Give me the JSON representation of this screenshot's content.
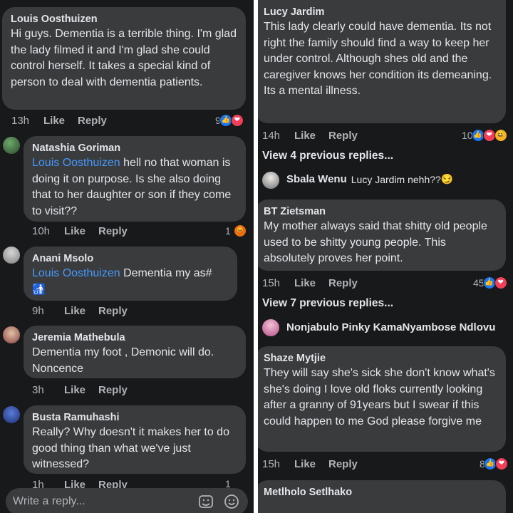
{
  "left": {
    "comments": [
      {
        "name": "Louis Oosthuizen",
        "text": "Hi guys. Dementia is a terrible thing. I'm glad the lady filmed it and I'm glad she could control herself. It takes a special kind of person to deal with dementia patients.",
        "time": "13h",
        "like": "Like",
        "reply": "Reply",
        "count": "9"
      },
      {
        "name": "Natashia Goriman",
        "mention": "Louis Oosthuizen",
        "text": " hell no that woman is doing it on purpose. Is she also doing that to her daughter or son if they come to visit??",
        "time": "10h",
        "like": "Like",
        "reply": "Reply",
        "count": "1"
      },
      {
        "name": "Anani Msolo",
        "mention": "Louis Oosthuizen",
        "text": " Dementia my as#",
        "emoji": "🚮",
        "time": "9h",
        "like": "Like",
        "reply": "Reply"
      },
      {
        "name": "Jeremia Mathebula",
        "text": "Dementia my foot , Demonic will do. Noncence",
        "time": "3h",
        "like": "Like",
        "reply": "Reply"
      },
      {
        "name": "Busta Ramuhashi",
        "text": "Really?  Why doesn't it makes her to do good thing than what we've just witnessed?",
        "time": "1h",
        "like": "Like",
        "reply": "Reply",
        "count": "1"
      }
    ],
    "composer": {
      "placeholder": "Write a reply..."
    }
  },
  "right": {
    "comments": [
      {
        "name": "Lucy Jardim",
        "text": "This lady clearly could have dementia. Its not right the family should find a way to keep her under control. Although shes old and the caregiver knows her condition its demeaning. Its a mental illness.",
        "time": "14h",
        "like": "Like",
        "reply": "Reply",
        "count": "10"
      },
      {
        "name": "BT Zietsman",
        "text": "My mother always said that shitty old people used to be shitty young people. This absolutely proves her point.",
        "time": "15h",
        "like": "Like",
        "reply": "Reply",
        "count": "45"
      },
      {
        "name": "Shaze Mytjie",
        "text": "They will say she's sick she don't know what's she's doing I love old floks currently looking after a granny of 91years but I swear if this could happen to me God please forgive me",
        "time": "15h",
        "like": "Like",
        "reply": "Reply",
        "count": "8"
      },
      {
        "name": "Metlholo Setlhako"
      }
    ],
    "previous_1": "View 4 previous replies...",
    "previous_2": "View 7 previous replies...",
    "reply_1": {
      "name": "Sbala Wenu",
      "text": "Lucy Jardim nehh??",
      "emoji": "😏"
    },
    "reply_2": {
      "name": "Nonjabulo Pinky KamaNyambose Ndlovu"
    }
  },
  "colors": {
    "background": "#18191a",
    "bubble": "#3a3b3c",
    "text": "#e4e6eb",
    "muted": "#b0b3b8",
    "mention": "#4599ff",
    "like_reaction": "#1877f2",
    "heart_reaction": "#f33e58"
  }
}
